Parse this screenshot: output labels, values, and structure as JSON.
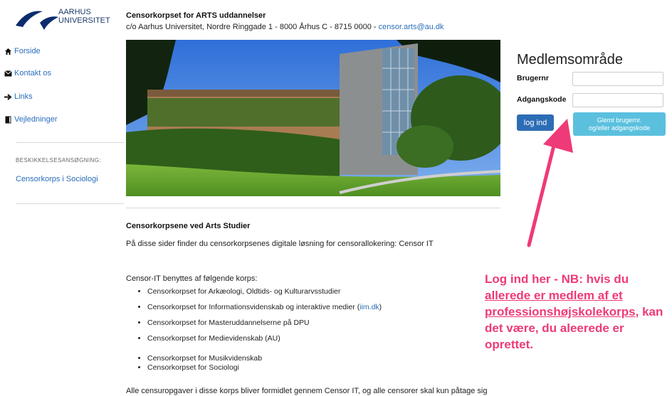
{
  "logo": {
    "line1": "AARHUS",
    "line2": "UNIVERSITET"
  },
  "sidebar": {
    "items": [
      {
        "label": "Forside",
        "icon": "home-icon"
      },
      {
        "label": "Kontakt os",
        "icon": "envelope-icon"
      },
      {
        "label": "Links",
        "icon": "arrow-right-icon"
      },
      {
        "label": "Vejledninger",
        "icon": "book-icon"
      }
    ],
    "caption": "BESKIKKELSESANSØGNING:",
    "link": "Censorkorps i Sociologi"
  },
  "header": {
    "title": "Censorkorpset for ARTS uddannelser",
    "address": "c/o Aarhus Universitet, Nordre Ringgade 1 - 8000 Århus C - 8715 0000 - ",
    "email": "censor.arts@au.dk"
  },
  "main": {
    "section_title": "Censorkorpsene ved Arts Studier",
    "intro": "På disse sider finder du censorkorpsenes digitale løsning for censorallokering: Censor IT",
    "list_intro": "Censor-IT benyttes af følgende korps:",
    "korps": [
      {
        "text": "Censorkorpset for Arkæologi, Oldtids- og Kulturarvsstudier"
      },
      {
        "text": "Censorkorpset for Informationsvidenskab og interaktive medier (",
        "link": "iim.dk",
        "suffix": ")"
      },
      {
        "text": "Censorkorpset for Masteruddannelserne på DPU"
      },
      {
        "text": "Censorkorpset for Medievidenskab (AU)"
      },
      {
        "text": "Censorkorpset for Musikvidenskab"
      },
      {
        "text": "Censorkorpset for Sociologi"
      }
    ],
    "footer_text": "Alle censuropgaver i disse korps bliver formidlet gennem Censor IT, og alle censorer skal kun påtage sig"
  },
  "member": {
    "title": "Medlemsområde",
    "username_label": "Brugernr",
    "password_label": "Adgangskode",
    "login_button": "log ind",
    "forgot_line1": "Glemt brugernr.",
    "forgot_line2": "og/eller adgangskode"
  },
  "annotation": {
    "text_part1": "Log ind her - NB: hvis du ",
    "underlined": "allerede er medlem af et professionshøjskolekorps",
    "text_part2": ", kan det være, du aleerede er oprettet.",
    "color": "#ee3a78"
  }
}
